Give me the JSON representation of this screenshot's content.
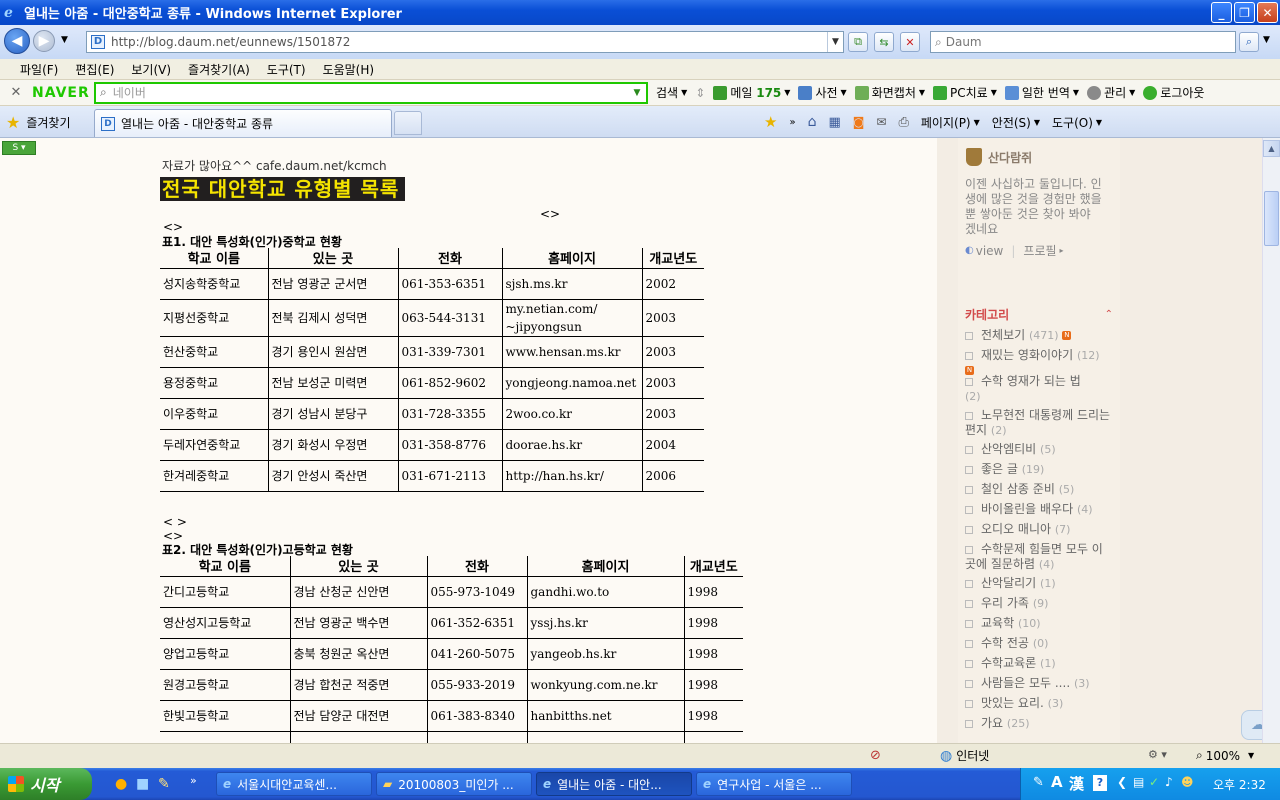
{
  "window": {
    "title": "열내는 아줌 - 대안중학교 종류 - Windows Internet Explorer",
    "buttons": {
      "minimize": "_",
      "maximize": "❐",
      "close": "✕"
    }
  },
  "address_bar": {
    "url": "http://blog.daum.net/eunnews/1501872",
    "search_placeholder": "Daum"
  },
  "menu": [
    "파일(F)",
    "편집(E)",
    "보기(V)",
    "즐겨찾기(A)",
    "도구(T)",
    "도움말(H)"
  ],
  "naver_toolbar": {
    "logo": "NAVER",
    "search_placeholder": "네이버",
    "search_label": "검색",
    "mail_label": "메일",
    "mail_count": "175",
    "items": [
      "사전",
      "화면캡처",
      "PC치료",
      "일한 번역",
      "관리",
      "로그아웃"
    ]
  },
  "tabs": {
    "favorites_label": "즐겨찾기",
    "active_tab": "열내는 아줌 - 대안중학교 종류",
    "tools": [
      "페이지(P)",
      "안전(S)",
      "도구(O)"
    ]
  },
  "article": {
    "source_note": "자료가 많아요^^ cafe.daum.net/kcmch",
    "title": "전국 대안학교 유형별 목록",
    "diamond": "<>",
    "diamond2": "<>",
    "diamond3": "< >",
    "diamond4": "<>",
    "table1": {
      "caption": "표1. 대안 특성화(인가)중학교 현황",
      "headers": [
        "학교 이름",
        "있는 곳",
        "전화",
        "홈페이지",
        "개교년도"
      ],
      "rows": [
        [
          "성지송학중학교",
          "전남 영광군 군서면",
          "061-353-6351",
          "sjsh.ms.kr",
          "2002"
        ],
        [
          "지평선중학교",
          "전북 김제시 성덕면",
          "063-544-3131",
          "my.netian.com/ ~jipyongsun",
          "2003"
        ],
        [
          "헌산중학교",
          "경기 용인시 원삼면",
          "031-339-7301",
          "www.hensan.ms.kr",
          "2003"
        ],
        [
          "용정중학교",
          "전남 보성군 미력면",
          "061-852-9602",
          "yongjeong.namoa.net",
          "2003"
        ],
        [
          "이우중학교",
          "경기 성남시 분당구",
          "031-728-3355",
          "2woo.co.kr",
          "2003"
        ],
        [
          "두레자연중학교",
          "경기 화성시 우정면",
          "031-358-8776",
          "doorae.hs.kr",
          "2004"
        ],
        [
          "한겨레중학교",
          "경기 안성시 죽산면",
          "031-671-2113",
          "http://han.hs.kr/",
          "2006"
        ]
      ]
    },
    "table2": {
      "caption": "표2. 대안 특성화(인가)고등학교 현황",
      "headers": [
        "학교 이름",
        "있는 곳",
        "전화",
        "홈페이지",
        "개교년도"
      ],
      "rows": [
        [
          "간디고등학교",
          "경남 산청군 신안면",
          "055-973-1049",
          "gandhi.wo.to",
          "1998"
        ],
        [
          "영산성지고등학교",
          "전남 영광군 백수면",
          "061-352-6351",
          "yssj.hs.kr",
          "1998"
        ],
        [
          "양업고등학교",
          "충북 청원군 옥산면",
          "041-260-5075",
          "yangeob.hs.kr",
          "1998"
        ],
        [
          "원경고등학교",
          "경남 합천군 적중면",
          "055-933-2019",
          "wonkyung.com.ne.kr",
          "1998"
        ],
        [
          "한빛고등학교",
          "전남 담양군 대전면",
          "061-383-8340",
          "hanbitths.net",
          "1998"
        ]
      ]
    }
  },
  "sidebar": {
    "profile_name": "산다람쥐",
    "profile_text": "이젠 사십하고 둘입니다. 인생에 많은 것을 경험만 했을 뿐 쌓아둔 것은 찾아 봐야 겠네요",
    "view_link": "view",
    "profile_link": "프로필",
    "category_heading": "카테고리",
    "categories": [
      {
        "name": "전체보기",
        "count": "(471)"
      },
      {
        "name": "재밌는 영화이야기",
        "count": "(12)"
      },
      {
        "name": "수학 영재가 되는 법",
        "count": "(2)"
      },
      {
        "name": "노무현전 대통령께 드리는 편지",
        "count": "(2)"
      },
      {
        "name": "산악엠티비",
        "count": "(5)"
      },
      {
        "name": "좋은 글",
        "count": "(19)"
      },
      {
        "name": "철인 삼종 준비",
        "count": "(5)"
      },
      {
        "name": "바이올린을 배우다",
        "count": "(4)"
      },
      {
        "name": "오디오 매니아",
        "count": "(7)"
      },
      {
        "name": "수학문제 힘들면 모두 이곳에 질문하렴",
        "count": "(4)"
      },
      {
        "name": "산악달리기",
        "count": "(1)"
      },
      {
        "name": "우리 가족",
        "count": "(9)"
      },
      {
        "name": "교육학",
        "count": "(10)"
      },
      {
        "name": "수학 전공",
        "count": "(0)"
      },
      {
        "name": "수학교육론",
        "count": "(1)"
      },
      {
        "name": "사람들은 모두 ....",
        "count": "(3)"
      },
      {
        "name": "맛있는 요리.",
        "count": "(3)"
      },
      {
        "name": "가요",
        "count": "(25)"
      }
    ]
  },
  "status_bar": {
    "zone": "인터넷",
    "zoom": "100%"
  },
  "taskbar": {
    "start": "시작",
    "tasks": [
      "서울시대안교육센...",
      "20100803_미인가 ...",
      "열내는 아줌 - 대안...",
      "연구사업 - 서울은 ..."
    ],
    "clock": "오후 2:32"
  }
}
